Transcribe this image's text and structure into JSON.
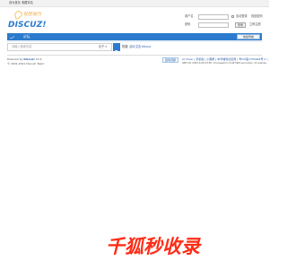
{
  "topbar": {
    "left_link_1": "设为首页",
    "left_link_2": "收藏本站"
  },
  "brand": {
    "logo_text": "DISCUZ!",
    "logo_slogan": "社区动力"
  },
  "login": {
    "username_label": "用户名",
    "password_label": "密码",
    "auto_login_label": "自动登录",
    "forgot_link": "找回密码",
    "login_button": "登录",
    "register_link": "立即注册"
  },
  "nav": {
    "home_label": "⌂",
    "forum_label": "论坛",
    "quick_nav_label": "快捷导航"
  },
  "search": {
    "placeholder": "请输入搜索内容",
    "scope_label": "帖子 ▾",
    "hot_label": "热搜:",
    "hot_terms": [
      "活动",
      "交友",
      "discuz"
    ]
  },
  "footer": {
    "powered_prefix": "Powered by",
    "product": "Discuz!",
    "version": "X3.4",
    "copyright": "© 2001-2021 Discuz! Team.",
    "back_to_top": "回到顶部",
    "links": "Archiver | 手机版 | 小黑屋 | 中华福利社区网 ( 粤ICP备1704646号-1 ) ",
    "server_info": "GMT+8, 2023-4-28 23:50 , Processed in 0.047463 second(s), 15 queries ."
  },
  "watermark": {
    "text": "千狐秒收录"
  },
  "colors": {
    "nav": "#2b7acd",
    "watermark": "#ff2c16",
    "link": "#2a5aa6"
  }
}
